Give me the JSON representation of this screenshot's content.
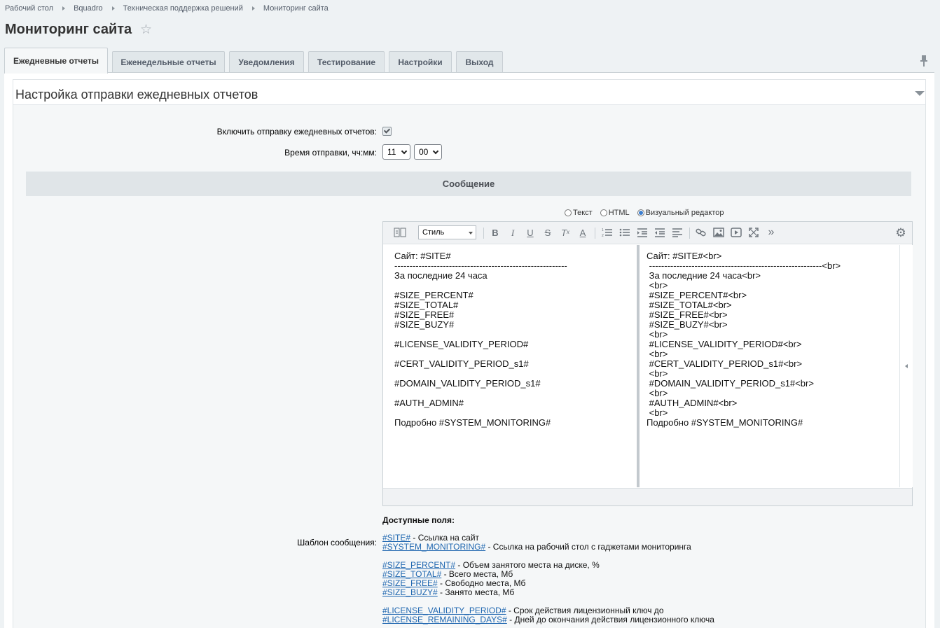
{
  "breadcrumb": [
    "Рабочий стол",
    "Bquadro",
    "Техническая поддержка решений",
    "Мониторинг сайта"
  ],
  "page": {
    "title": "Мониторинг сайта"
  },
  "tabs": [
    "Ежедневные отчеты",
    "Еженедельные отчеты",
    "Уведомления",
    "Тестирование",
    "Настройки",
    "Выход"
  ],
  "section": {
    "title": "Настройка отправки ежедневных отчетов"
  },
  "form": {
    "enable_label": "Включить отправку ежедневных отчетов:",
    "enable_checked": true,
    "time_label": "Время отправки, чч:мм:",
    "hour": "11",
    "minute": "00",
    "message_header": "Сообщение",
    "template_label": "Шаблон сообщения:"
  },
  "modes": [
    "Текст",
    "HTML",
    "Визуальный редактор"
  ],
  "selected_mode": "Визуальный редактор",
  "editor": {
    "style_label": "Стиль",
    "visual": "Сайт: #SITE#\n---------------------------------------------------------\nЗа последние 24 часа\n\n#SIZE_PERCENT#\n#SIZE_TOTAL#\n#SIZE_FREE#\n#SIZE_BUZY#\n\n#LICENSE_VALIDITY_PERIOD#\n\n#CERT_VALIDITY_PERIOD_s1#\n\n#DOMAIN_VALIDITY_PERIOD_s1#\n\n#AUTH_ADMIN#\n\nПодробно #SYSTEM_MONITORING#",
    "source": "Сайт: #SITE#<br>\n ---------------------------------------------------------<br>\n За последние 24 часа<br>\n <br>\n #SIZE_PERCENT#<br>\n #SIZE_TOTAL#<br>\n #SIZE_FREE#<br>\n #SIZE_BUZY#<br>\n <br>\n #LICENSE_VALIDITY_PERIOD#<br>\n <br>\n #CERT_VALIDITY_PERIOD_s1#<br>\n <br>\n #DOMAIN_VALIDITY_PERIOD_s1#<br>\n <br>\n #AUTH_ADMIN#<br>\n <br>\nПодробно #SYSTEM_MONITORING#"
  },
  "fields": {
    "title": "Доступные поля:",
    "items": [
      {
        "code": "#SITE#",
        "desc": " - Ссылка на сайт"
      },
      {
        "code": "#SYSTEM_MONITORING#",
        "desc": " - Ссылка на рабочий стол с гаджетами мониторинга"
      },
      {
        "code": "#SIZE_PERCENT#",
        "desc": " - Объем занятого места на диске, %"
      },
      {
        "code": "#SIZE_TOTAL#",
        "desc": " - Всего места, Мб"
      },
      {
        "code": "#SIZE_FREE#",
        "desc": " - Свободно места, Мб"
      },
      {
        "code": "#SIZE_BUZY#",
        "desc": " - Занято места, Мб"
      },
      {
        "code": "#LICENSE_VALIDITY_PERIOD#",
        "desc": " - Срок действия лицензионный ключ до"
      },
      {
        "code": "#LICENSE_REMAINING_DAYS#",
        "desc": " - Дней до окончания действия лицензионного ключа"
      }
    ]
  }
}
